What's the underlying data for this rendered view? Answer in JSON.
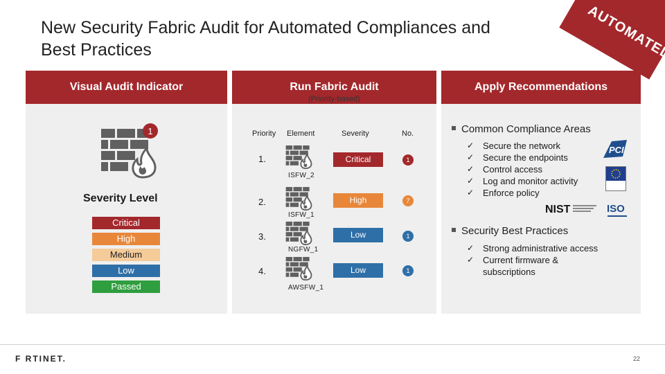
{
  "slide": {
    "title_line1": "New Security Fabric Audit for Automated Compliances and",
    "title_line2": "Best Practices",
    "badge": "AUTOMATED",
    "page_number": "22"
  },
  "columns": {
    "visual": "Visual Audit Indicator",
    "run": "Run Fabric Audit",
    "run_note": "(Priority-based)",
    "apply": "Apply Recommendations"
  },
  "visual_audit": {
    "notification_count": "1",
    "severity_title": "Severity Level",
    "levels": [
      {
        "label": "Critical",
        "color": "#a3282c",
        "text_color": "#ffffff"
      },
      {
        "label": "High",
        "color": "#e8873a",
        "text_color": "#ffffff"
      },
      {
        "label": "Medium",
        "color": "#f5cb9a",
        "text_color": "#222222"
      },
      {
        "label": "Low",
        "color": "#2f6fa8",
        "text_color": "#ffffff"
      },
      {
        "label": "Passed",
        "color": "#2f9e3f",
        "text_color": "#ffffff"
      }
    ]
  },
  "audit_table": {
    "headers": {
      "priority": "Priority",
      "element": "Element",
      "severity": "Severity",
      "no": "No."
    },
    "rows": [
      {
        "priority": "1.",
        "element": "ISFW_2",
        "severity": "Critical",
        "severity_color": "#a3282c",
        "no": "1",
        "no_color": "#a3282c"
      },
      {
        "priority": "2.",
        "element": "ISFW_1",
        "severity": "High",
        "severity_color": "#e8873a",
        "no": "7",
        "no_color": "#e8873a"
      },
      {
        "priority": "3.",
        "element": "NGFW_1",
        "severity": "Low",
        "severity_color": "#2f6fa8",
        "no": "1",
        "no_color": "#2f6fa8"
      },
      {
        "priority": "4.",
        "element": "AWSFW_1",
        "severity": "Low",
        "severity_color": "#2f6fa8",
        "no": "1",
        "no_color": "#2f6fa8"
      }
    ]
  },
  "recommendations": {
    "compliance_title": "Common Compliance Areas",
    "compliance_items": [
      "Secure the network",
      "Secure the endpoints",
      "Control access",
      "Log and monitor activity",
      "Enforce policy"
    ],
    "best_practices_title": "Security Best Practices",
    "best_practice_items": [
      "Strong administrative access",
      "Current firmware &",
      "subscriptions"
    ],
    "logos": {
      "pci": "PCI",
      "nist": "NIST",
      "iso": "ISO"
    }
  },
  "footer": {
    "brand": "F RTINET."
  },
  "colors": {
    "accent": "#a3282c",
    "panel": "#efefef",
    "icon": "#606060"
  }
}
